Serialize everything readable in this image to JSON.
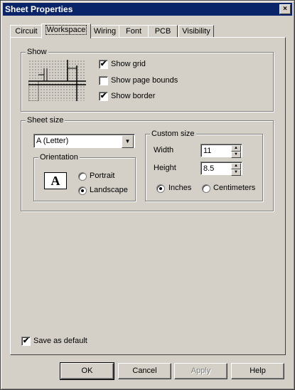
{
  "window": {
    "title": "Sheet Properties",
    "close_glyph": "×"
  },
  "tabs": [
    {
      "label": "Circuit"
    },
    {
      "label": "Workspace"
    },
    {
      "label": "Wiring"
    },
    {
      "label": "Font"
    },
    {
      "label": "PCB"
    },
    {
      "label": "Visibility"
    }
  ],
  "active_tab": "Workspace",
  "show_group": {
    "legend": "Show",
    "preview_icon": "schematic-preview-icon",
    "options": [
      {
        "label": "Show grid",
        "checked": true
      },
      {
        "label": "Show page bounds",
        "checked": false
      },
      {
        "label": "Show border",
        "checked": true
      }
    ]
  },
  "sheet_size": {
    "legend": "Sheet size",
    "size_select": "A (Letter)",
    "orientation": {
      "legend": "Orientation",
      "icon": "A",
      "options": [
        {
          "label": "Portrait",
          "selected": false
        },
        {
          "label": "Landscape",
          "selected": true
        }
      ]
    },
    "custom_size": {
      "legend": "Custom size",
      "width_label": "Width",
      "width_value": "11",
      "height_label": "Height",
      "height_value": "8.5",
      "units": [
        {
          "label": "Inches",
          "selected": true
        },
        {
          "label": "Centimeters",
          "selected": false
        }
      ]
    }
  },
  "save_default": {
    "label": "Save as default",
    "checked": true
  },
  "buttons": {
    "ok": "OK",
    "cancel": "Cancel",
    "apply": "Apply",
    "help": "Help"
  },
  "check_glyph": "✔"
}
